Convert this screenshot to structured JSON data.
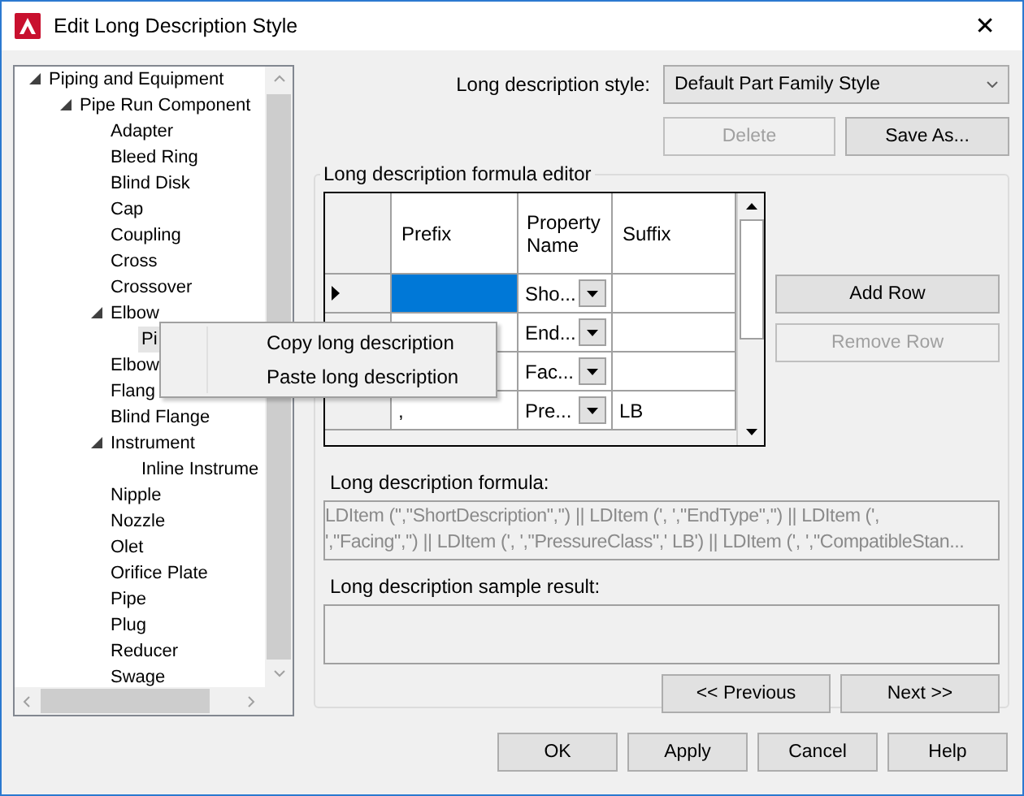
{
  "window": {
    "title": "Edit Long Description Style",
    "close": "✕"
  },
  "tree": {
    "items": [
      {
        "label": "Piping and Equipment",
        "selected": false,
        "expanded": true,
        "children": [
          {
            "label": "Pipe Run Component",
            "selected": false,
            "expanded": true,
            "children": [
              {
                "label": "Adapter",
                "selected": false
              },
              {
                "label": "Bleed Ring",
                "selected": false
              },
              {
                "label": "Blind Disk",
                "selected": false
              },
              {
                "label": "Cap",
                "selected": false
              },
              {
                "label": "Coupling",
                "selected": false
              },
              {
                "label": "Cross",
                "selected": false
              },
              {
                "label": "Crossover",
                "selected": false
              },
              {
                "label": "Elbow",
                "selected": false,
                "expanded": true,
                "children": [
                  {
                    "label": "Pi",
                    "selected": true
                  }
                ]
              },
              {
                "label": "Elbow",
                "selected": false
              },
              {
                "label": "Flang",
                "selected": false
              },
              {
                "label": "Blind Flange",
                "selected": false
              },
              {
                "label": "Instrument",
                "selected": false,
                "expanded": true,
                "children": [
                  {
                    "label": "Inline Instrume",
                    "selected": false
                  }
                ]
              },
              {
                "label": "Nipple",
                "selected": false
              },
              {
                "label": "Nozzle",
                "selected": false
              },
              {
                "label": "Olet",
                "selected": false
              },
              {
                "label": "Orifice Plate",
                "selected": false
              },
              {
                "label": "Pipe",
                "selected": false
              },
              {
                "label": "Plug",
                "selected": false
              },
              {
                "label": "Reducer",
                "selected": false
              },
              {
                "label": "Swage",
                "selected": false
              }
            ]
          }
        ]
      }
    ]
  },
  "style_label": "Long description style:",
  "style_value": "Default Part Family Style",
  "style_buttons": [
    {
      "label": "Delete",
      "disabled": true
    },
    {
      "label": "Save As...",
      "disabled": false
    }
  ],
  "editor": {
    "legend": "Long description formula editor",
    "columns": [
      "Prefix",
      "Property Name",
      "Suffix"
    ],
    "rows": [
      {
        "current": true,
        "prefix_selected": true,
        "property": "Sho..."
      },
      {
        "prefix_selected": false,
        "property": "End..."
      },
      {
        "prefix_selected": false,
        "property": "Fac..."
      },
      {
        "current": false,
        "prefix_selected": false,
        "prefix": ",",
        "property": "Pre...",
        "suffix": "LB"
      }
    ],
    "row_buttons": [
      {
        "label": "Add Row",
        "disabled": false
      },
      {
        "label": "Remove Row",
        "disabled": true
      }
    ],
    "formula_label": "Long description formula:",
    "formula_lines": [
      "LDItem ('',\"ShortDescription\",'') || LDItem (', ',\"EndType\",'') || LDItem (',",
      "',\"Facing\",'') || LDItem (', ',\"PressureClass\",' LB') || LDItem (', ',\"CompatibleStan..."
    ],
    "sample_label": "Long description sample result:",
    "nav_buttons": [
      {
        "label": "<< Previous"
      },
      {
        "label": "Next >>"
      }
    ]
  },
  "context_menu": {
    "items": [
      {
        "label": "Copy long description"
      },
      {
        "label": "Paste long description"
      }
    ]
  },
  "buttons": [
    {
      "label": "OK"
    },
    {
      "label": "Apply"
    },
    {
      "label": "Cancel"
    },
    {
      "label": "Help"
    }
  ]
}
